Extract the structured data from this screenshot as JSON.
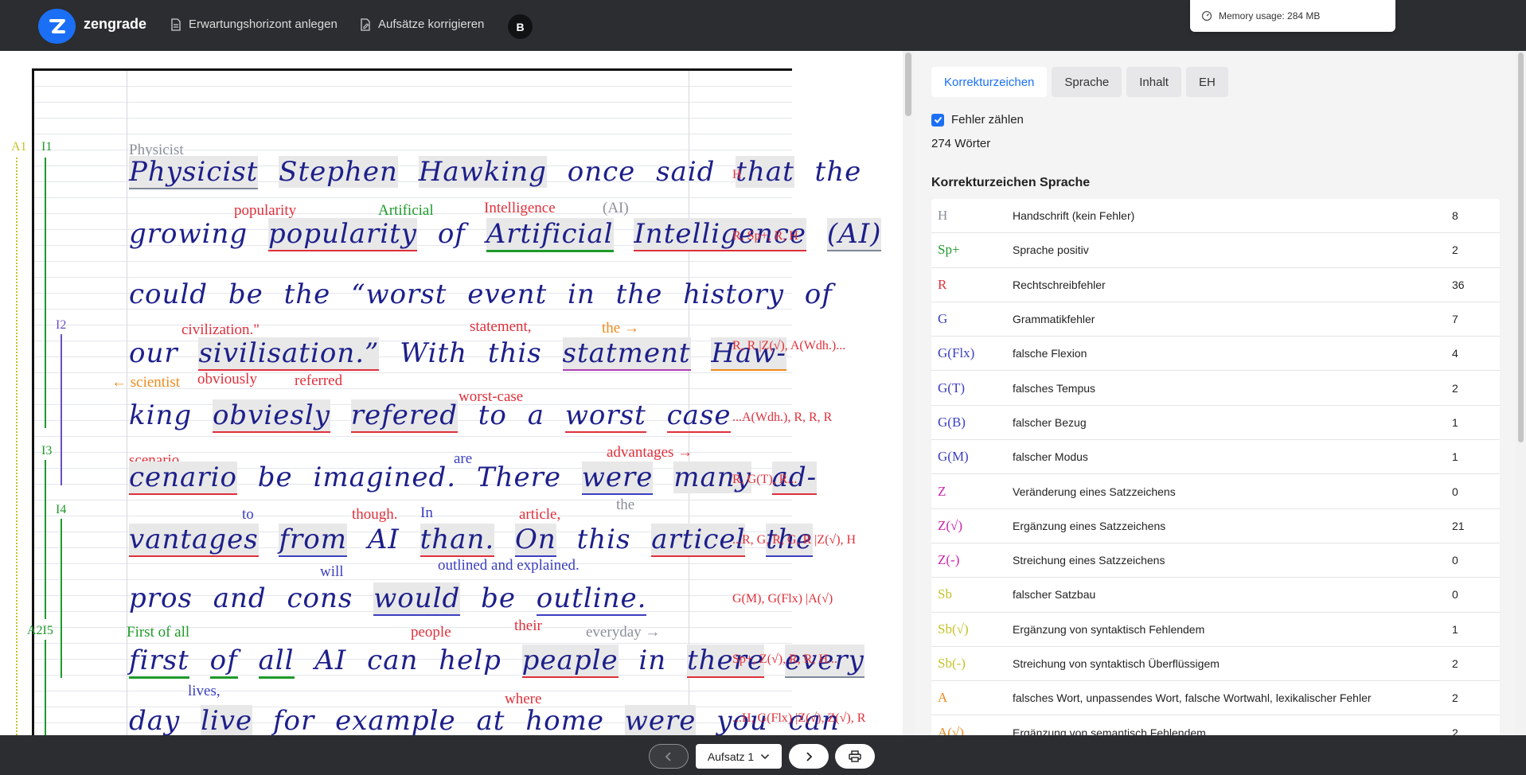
{
  "app": {
    "name": "zengrade",
    "avatar_initial": "B",
    "memory_label": "Memory usage: 284 MB"
  },
  "nav": [
    {
      "label": "Erwartungshorizont anlegen",
      "icon": "document-icon"
    },
    {
      "label": "Aufsätze korrigieren",
      "icon": "document-edit-icon"
    }
  ],
  "colors": {
    "accent": "#1b6ff5",
    "topbar": "#2b2d31",
    "ink": "#1d1f8a"
  },
  "essay": {
    "margin_tags": [
      "A1",
      "I1",
      "I2",
      "I3",
      "I4",
      "A2I5"
    ],
    "lines": [
      {
        "top_annotation": "Physicist",
        "text": [
          "Physicist",
          "Stephen",
          "Hawking",
          "once",
          "said",
          "that",
          "the"
        ],
        "codes": "H"
      },
      {
        "annotations": [
          "popularity",
          "Artificial",
          "Intelligence",
          "(AI)"
        ],
        "text": [
          "growing",
          "popularity",
          "of",
          "Artificial",
          "Intelligence",
          "(AI)"
        ],
        "codes": "R, Sp+, R, H"
      },
      {
        "text": [
          "could",
          "be",
          "the",
          "“worst",
          "event",
          "in",
          "the",
          "history",
          "of"
        ],
        "codes": ""
      },
      {
        "annotations": [
          "civilization.\"",
          "statement,",
          "the →"
        ],
        "text": [
          "our",
          "sivilisation.”",
          "With",
          "this",
          "statment",
          "Haw-"
        ],
        "codes": "R, R |Z(√), A(Wdh.)..."
      },
      {
        "annotations": [
          "← scientist",
          "obviously",
          "referred",
          "worst-case"
        ],
        "text": [
          "king",
          "obviesly",
          "refered",
          "to",
          "a",
          "worst",
          "case"
        ],
        "codes": "...A(Wdh.), R, R, R"
      },
      {
        "annotations": [
          "scenario",
          "are",
          "advantages →"
        ],
        "text": [
          "cenario",
          "be",
          "imagined.",
          "There",
          "were",
          "many",
          "ad-"
        ],
        "codes": "R, G(T), R..."
      },
      {
        "annotations": [
          "to",
          "though.",
          "In",
          "article,",
          "the"
        ],
        "text": [
          "vantages",
          "from",
          "AI",
          "than.",
          "On",
          "this",
          "articel",
          "the"
        ],
        "codes": "...R, G, R, G, R |Z(√), H"
      },
      {
        "annotations": [
          "will",
          "outlined and explained."
        ],
        "text": [
          "pros",
          "and",
          "cons",
          "would",
          "be",
          "outline."
        ],
        "codes": "G(M), G(Flx) |A(√)"
      },
      {
        "annotations": [
          "First of all",
          "people",
          "their",
          "everyday →"
        ],
        "text": [
          "first",
          "of",
          "all",
          "AI",
          "can",
          "help",
          "peaple",
          "in",
          "there",
          "every"
        ],
        "codes": "Sp+, Z(√), R, R, H..."
      },
      {
        "annotations": [
          "lives,",
          "where"
        ],
        "text": [
          "day",
          "live",
          "for",
          "example",
          "at",
          "home",
          "were",
          "you",
          "can"
        ],
        "codes": "...H, G(Flx) |Z(√), Z(√), R"
      }
    ]
  },
  "panel": {
    "tabs": [
      "Korrekturzeichen",
      "Sprache",
      "Inhalt",
      "EH"
    ],
    "active_tab": "Korrekturzeichen",
    "checkbox_label": "Fehler zählen",
    "checkbox_checked": true,
    "word_count": "274 Wörter",
    "section_title": "Korrekturzeichen Sprache",
    "rows": [
      {
        "symbol": "H",
        "color": "#8c8f99",
        "label": "Handschrift (kein Fehler)",
        "count": "8"
      },
      {
        "symbol": "Sp+",
        "color": "#1e9a2a",
        "label": "Sprache positiv",
        "count": "2"
      },
      {
        "symbol": "R",
        "color": "#e0303b",
        "label": "Rechtschreibfehler",
        "count": "36"
      },
      {
        "symbol": "G",
        "color": "#3b3fbf",
        "label": "Grammatikfehler",
        "count": "7"
      },
      {
        "symbol": "G(Flx)",
        "color": "#3b3fbf",
        "label": "falsche Flexion",
        "count": "4"
      },
      {
        "symbol": "G(T)",
        "color": "#3b3fbf",
        "label": "falsches Tempus",
        "count": "2"
      },
      {
        "symbol": "G(B)",
        "color": "#3b3fbf",
        "label": "falscher Bezug",
        "count": "1"
      },
      {
        "symbol": "G(M)",
        "color": "#3b3fbf",
        "label": "falscher Modus",
        "count": "1"
      },
      {
        "symbol": "Z",
        "color": "#cc22aa",
        "label": "Veränderung eines Satzzeichens",
        "count": "0"
      },
      {
        "symbol": "Z(√)",
        "color": "#cc22aa",
        "label": "Ergänzung eines Satzzeichens",
        "count": "21"
      },
      {
        "symbol": "Z(-)",
        "color": "#cc22aa",
        "label": "Streichung eines Satzzeichens",
        "count": "0"
      },
      {
        "symbol": "Sb",
        "color": "#c6c227",
        "label": "falscher Satzbau",
        "count": "0"
      },
      {
        "symbol": "Sb(√)",
        "color": "#c6c227",
        "label": "Ergänzung von syntaktisch Fehlendem",
        "count": "1"
      },
      {
        "symbol": "Sb(-)",
        "color": "#c6c227",
        "label": "Streichung von syntaktisch Überflüssigem",
        "count": "2"
      },
      {
        "symbol": "A",
        "color": "#ee8a1c",
        "label": "falsches Wort, unpassendes Wort, falsche Wortwahl, lexikalischer Fehler",
        "count": "2"
      },
      {
        "symbol": "A(√)",
        "color": "#ee8a1c",
        "label": "Ergänzung von semantisch Fehlendem",
        "count": "2"
      }
    ]
  },
  "footer": {
    "select_label": "Aufsatz 1"
  }
}
